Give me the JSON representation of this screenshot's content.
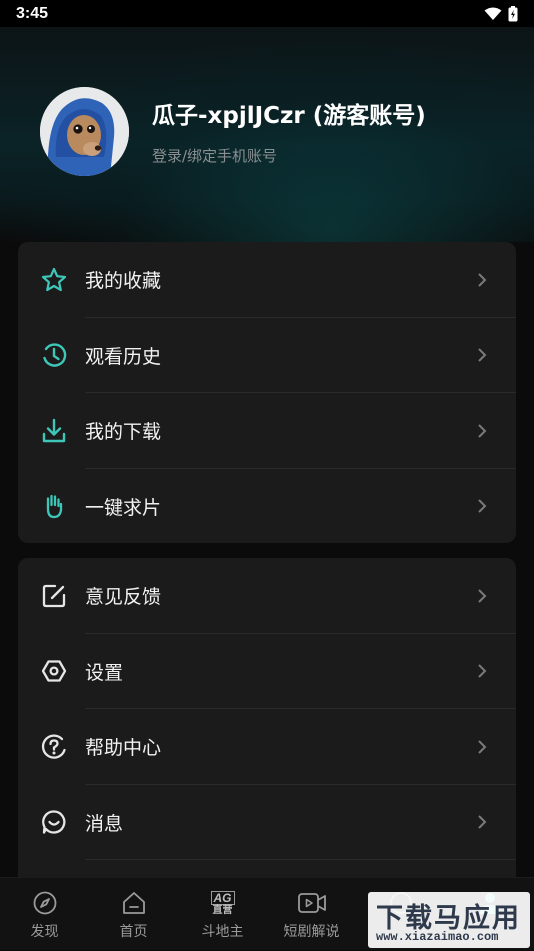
{
  "status_bar": {
    "time": "3:45"
  },
  "profile": {
    "username": "瓜子-xpjlJCzr (游客账号)",
    "login_link": "登录/绑定手机账号"
  },
  "menu_group_1": [
    {
      "label": "我的收藏",
      "icon": "star-icon"
    },
    {
      "label": "观看历史",
      "icon": "clock-icon"
    },
    {
      "label": "我的下载",
      "icon": "download-icon"
    },
    {
      "label": "一键求片",
      "icon": "hand-icon"
    }
  ],
  "menu_group_2": [
    {
      "label": "意见反馈",
      "icon": "edit-icon"
    },
    {
      "label": "设置",
      "icon": "hexagon-gear-icon"
    },
    {
      "label": "帮助中心",
      "icon": "help-icon"
    },
    {
      "label": "消息",
      "icon": "message-icon"
    }
  ],
  "tab_bar": [
    {
      "label": "发现",
      "icon": "compass-icon"
    },
    {
      "label": "首页",
      "icon": "home-icon"
    },
    {
      "label": "斗地主",
      "icon": "ag-badge-icon",
      "badge_top": "AG",
      "badge_bottom": "直营"
    },
    {
      "label": "短剧解说",
      "icon": "video-icon"
    },
    {
      "label": "",
      "icon": "tab-icon"
    },
    {
      "label": "",
      "icon": "user-icon",
      "active": true
    }
  ],
  "watermark": {
    "title": "下载马应用",
    "url": "www.xiazaimao.com"
  },
  "colors": {
    "accent": "#3ec7b8",
    "card": "#1b1b1b",
    "background": "#0b0b0b"
  }
}
